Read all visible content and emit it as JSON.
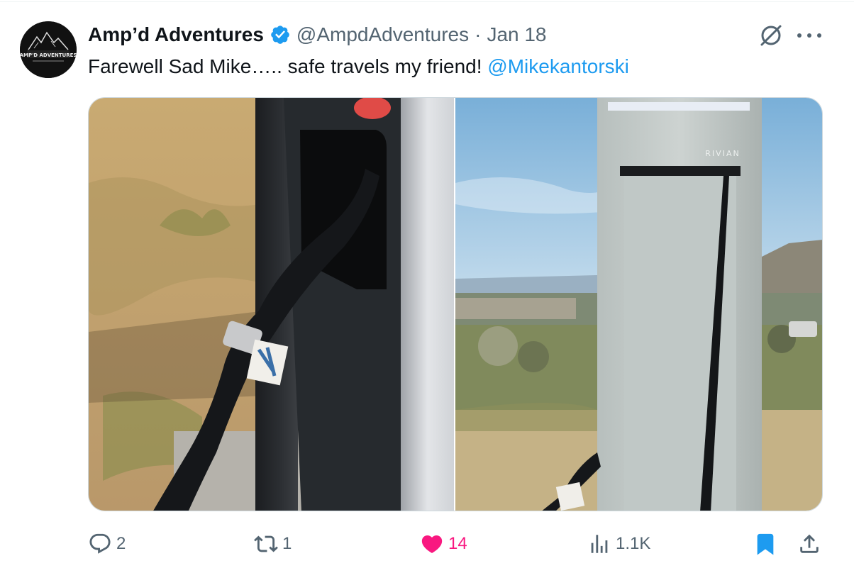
{
  "tweet": {
    "display_name": "Amp’d Adventures",
    "handle": "@AmpdAdventures",
    "separator": "·",
    "date": "Jan 18",
    "text": "Farewell Sad Mike….. safe travels my friend! ",
    "mention": "@Mikekantorski",
    "avatar_text": "AMP'D ADVENTURES",
    "photo2_brand": "RIVIAN"
  },
  "actions": {
    "replies": "2",
    "reposts": "1",
    "likes": "14",
    "views": "1.1K"
  },
  "colors": {
    "link": "#1d9bf0",
    "like": "#f91880",
    "muted": "#536471",
    "verified": "#1d9bf0"
  },
  "icons": [
    "verified-badge-icon",
    "grok-icon",
    "more-icon",
    "reply-icon",
    "repost-icon",
    "heart-icon",
    "views-icon",
    "bookmark-icon",
    "share-icon"
  ]
}
